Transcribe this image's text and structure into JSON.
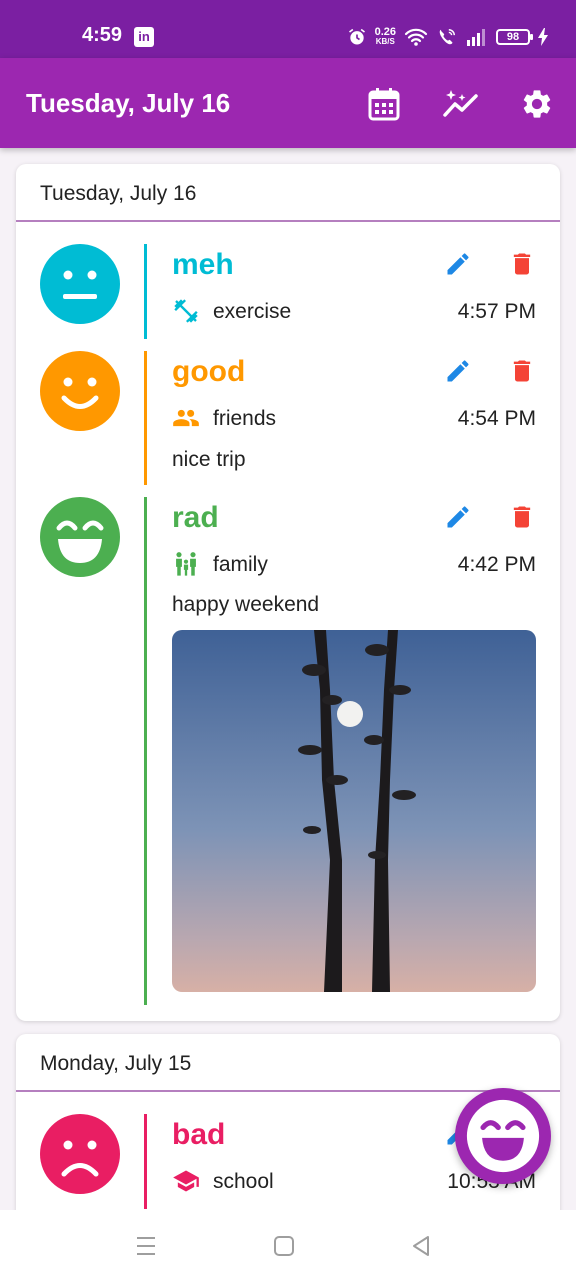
{
  "status_bar": {
    "time": "4:59",
    "app_icon": "in",
    "net_speed_value": "0.26",
    "net_speed_unit": "KB/S",
    "battery": "98"
  },
  "app_bar": {
    "title": "Tuesday, July 16",
    "actions": [
      "calendar-icon",
      "insights-icon",
      "settings-icon"
    ]
  },
  "colors": {
    "primary": "#9c27b0",
    "status_bar": "#7b1fa2",
    "edit": "#1e88e5",
    "delete": "#f44336",
    "meh": "#00bcd4",
    "good": "#ff9800",
    "rad": "#4caf50",
    "bad": "#e91e63"
  },
  "days": [
    {
      "date": "Tuesday, July 16",
      "entries": [
        {
          "mood": "meh",
          "activity": "exercise",
          "activity_icon": "dumbbell-icon",
          "time": "4:57 PM"
        },
        {
          "mood": "good",
          "activity": "friends",
          "activity_icon": "people-icon",
          "time": "4:54 PM",
          "note": "nice trip"
        },
        {
          "mood": "rad",
          "activity": "family",
          "activity_icon": "family-icon",
          "time": "4:42 PM",
          "note": "happy weekend",
          "photo": "moon-between-trees-photo"
        }
      ]
    },
    {
      "date": "Monday, July 15",
      "entries": [
        {
          "mood": "bad",
          "activity": "school",
          "activity_icon": "school-icon",
          "time": "10:53 AM"
        }
      ]
    }
  ],
  "fab": {
    "icon": "rad-face-icon"
  },
  "nav_bar": {
    "buttons": [
      "menu-icon",
      "home-icon",
      "back-icon"
    ]
  }
}
